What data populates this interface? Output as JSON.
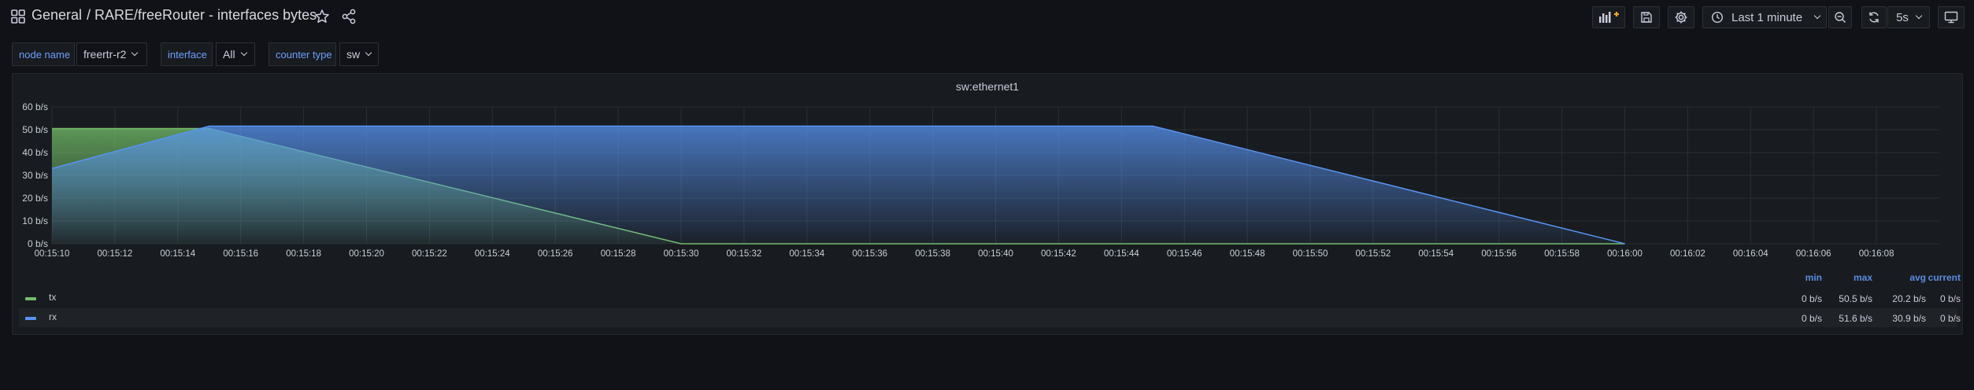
{
  "breadcrumb": {
    "folder": "General",
    "title": "/ RARE/freeRouter - interfaces bytes"
  },
  "toolbar": {
    "time_range": "Last 1 minute",
    "refresh_interval": "5s"
  },
  "variables": [
    {
      "label": "node name",
      "value": "freertr-r2"
    },
    {
      "label": "interface",
      "value": "All"
    },
    {
      "label": "counter type",
      "value": "sw"
    }
  ],
  "panel": {
    "title": "sw:ethernet1",
    "legend_headers": [
      "min",
      "max",
      "avg",
      "current"
    ],
    "legend": [
      {
        "name": "tx",
        "color": "#73bf69",
        "min": "0 b/s",
        "max": "50.5 b/s",
        "avg": "20.2 b/s",
        "current": "0 b/s"
      },
      {
        "name": "rx",
        "color": "#5794f2",
        "min": "0 b/s",
        "max": "51.6 b/s",
        "avg": "30.9 b/s",
        "current": "0 b/s"
      }
    ]
  },
  "chart_data": {
    "type": "area",
    "title": "sw:ethernet1",
    "ylim": [
      0,
      60
    ],
    "yticks": [
      "0 b/s",
      "10 b/s",
      "20 b/s",
      "30 b/s",
      "40 b/s",
      "50 b/s",
      "60 b/s"
    ],
    "xticks": [
      "00:15:10",
      "00:15:12",
      "00:15:14",
      "00:15:16",
      "00:15:18",
      "00:15:20",
      "00:15:22",
      "00:15:24",
      "00:15:26",
      "00:15:28",
      "00:15:30",
      "00:15:32",
      "00:15:34",
      "00:15:36",
      "00:15:38",
      "00:15:40",
      "00:15:42",
      "00:15:44",
      "00:15:46",
      "00:15:48",
      "00:15:50",
      "00:15:52",
      "00:15:54",
      "00:15:56",
      "00:15:58",
      "00:16:00",
      "00:16:02",
      "00:16:04",
      "00:16:06",
      "00:16:08"
    ],
    "grid": true,
    "series": [
      {
        "name": "tx",
        "color": "#73bf69",
        "x": [
          "00:15:10",
          "00:15:15",
          "00:15:30",
          "00:16:00"
        ],
        "values": [
          50.5,
          50.5,
          0,
          0
        ]
      },
      {
        "name": "rx",
        "color": "#5794f2",
        "x": [
          "00:15:10",
          "00:15:15",
          "00:15:45",
          "00:16:00"
        ],
        "values": [
          33,
          51.6,
          51.6,
          0
        ]
      }
    ]
  }
}
